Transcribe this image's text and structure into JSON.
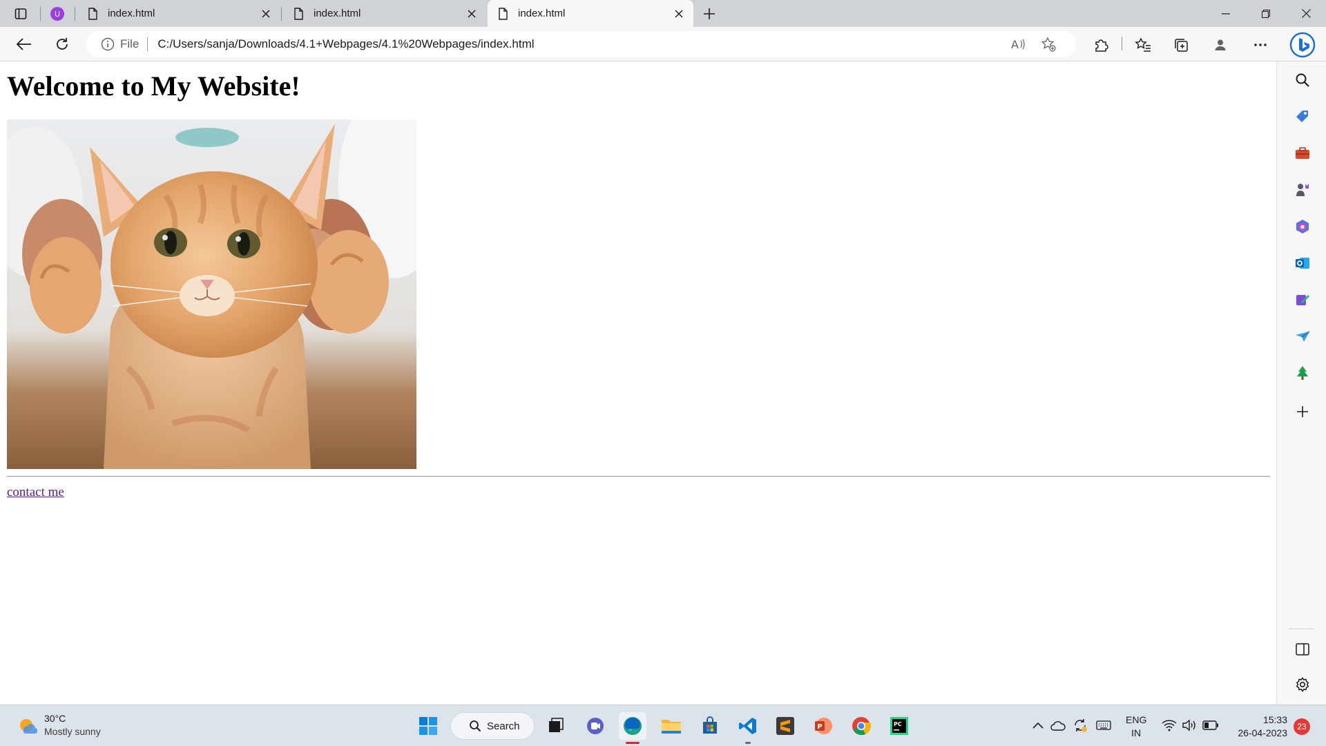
{
  "browser": {
    "tabs": [
      {
        "title": "index.html",
        "active": false
      },
      {
        "title": "index.html",
        "active": false
      },
      {
        "title": "index.html",
        "active": true
      }
    ],
    "address": {
      "scheme_label": "File",
      "url": "C:/Users/sanja/Downloads/4.1+Webpages/4.1%20Webpages/index.html"
    },
    "sidebar_icons": [
      "search-icon",
      "shopping-tag-icon",
      "tools-icon",
      "games-icon",
      "microsoft-365-icon",
      "outlook-icon",
      "drop-icon",
      "send-icon",
      "tree-icon",
      "add-icon",
      "split-screen-icon",
      "settings-icon"
    ]
  },
  "page": {
    "heading": "Welcome to My Website!",
    "image_alt": "kitten photo",
    "link_text": "contact me"
  },
  "taskbar": {
    "weather": {
      "temp": "30°C",
      "condition": "Mostly sunny"
    },
    "search_label": "Search",
    "apps": [
      "windows-start-icon",
      "search-icon",
      "task-view-icon",
      "teams-chat-icon",
      "edge-icon",
      "file-explorer-icon",
      "store-icon",
      "vscode-icon",
      "sublime-text-icon",
      "powerpoint-icon",
      "chrome-icon",
      "pycharm-icon"
    ],
    "language": {
      "line1": "ENG",
      "line2": "IN"
    },
    "clock": {
      "time": "15:33",
      "date": "26-04-2023"
    },
    "notifications": "23"
  },
  "colors": {
    "tab_strip": "#cfd3d8",
    "toolbar": "#f7f7f7",
    "link_visited": "#551a8b",
    "taskbar": "#dde3ea",
    "accent_edge": "#0a66c2"
  }
}
